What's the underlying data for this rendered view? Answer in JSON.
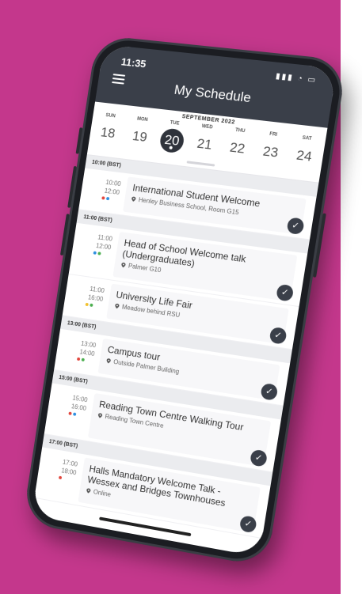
{
  "status": {
    "time": "11:35",
    "icons": "▮▮▮ ◔ ▭"
  },
  "header": {
    "title": "My Schedule"
  },
  "week": {
    "month": "SEPTEMBER 2022",
    "days": [
      {
        "name": "SUN",
        "num": "18"
      },
      {
        "name": "MON",
        "num": "19"
      },
      {
        "name": "TUE",
        "num": "20",
        "selected": true
      },
      {
        "name": "WED",
        "num": "21"
      },
      {
        "name": "THU",
        "num": "22"
      },
      {
        "name": "FRI",
        "num": "23"
      },
      {
        "name": "SAT",
        "num": "24"
      }
    ]
  },
  "colors": {
    "header": "#3a3f49",
    "background": "#c4378c",
    "dot_red": "#e2453c",
    "dot_blue": "#2f8fe0",
    "dot_green": "#4caf50",
    "dot_yellow": "#f2c12e"
  },
  "sections": [
    {
      "label": "10:00 (BST)",
      "events": [
        {
          "start": "10:00",
          "end": "12:00",
          "title": "International Student Welcome",
          "location": "Henley Business School, Room G15",
          "dots": [
            "dot_red",
            "dot_blue"
          ]
        }
      ]
    },
    {
      "label": "11:00 (BST)",
      "events": [
        {
          "start": "11:00",
          "end": "12:00",
          "title": "Head of School Welcome talk (Undergraduates)",
          "location": "Palmer G10",
          "dots": [
            "dot_blue",
            "dot_green"
          ],
          "tall": true
        },
        {
          "start": "11:00",
          "end": "16:00",
          "title": "University Life Fair",
          "location": "Meadow behind RSU",
          "dots": [
            "dot_yellow",
            "dot_green"
          ]
        }
      ]
    },
    {
      "label": "13:00 (BST)",
      "events": [
        {
          "start": "13:00",
          "end": "14:00",
          "title": "Campus tour",
          "location": "Outside Palmer Building",
          "dots": [
            "dot_red",
            "dot_green"
          ]
        }
      ]
    },
    {
      "label": "15:00 (BST)",
      "events": [
        {
          "start": "15:00",
          "end": "16:00",
          "title": "Reading Town Centre Walking Tour",
          "location": "Reading Town Centre",
          "dots": [
            "dot_red",
            "dot_blue"
          ],
          "tall": true
        }
      ]
    },
    {
      "label": "17:00 (BST)",
      "events": [
        {
          "start": "17:00",
          "end": "18:00",
          "title": "Halls Mandatory Welcome Talk - Wessex and Bridges Townhouses",
          "location": "Online",
          "dots": [
            "dot_red"
          ],
          "tall": true
        }
      ]
    }
  ]
}
